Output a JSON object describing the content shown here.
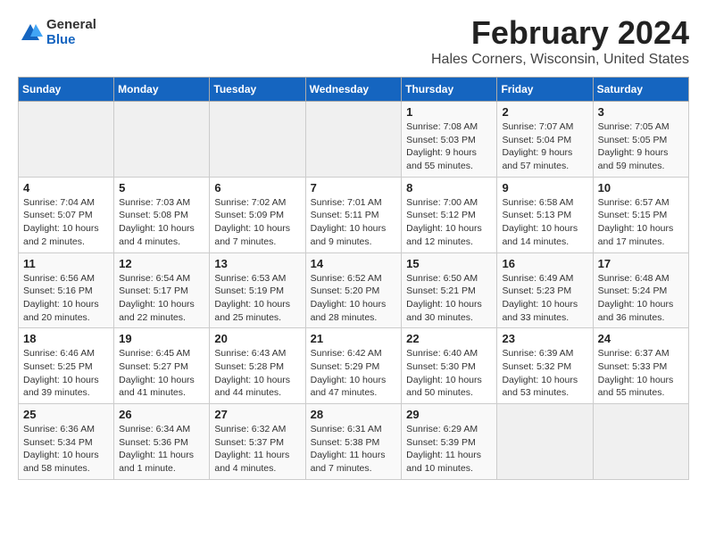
{
  "logo": {
    "general": "General",
    "blue": "Blue"
  },
  "title": "February 2024",
  "subtitle": "Hales Corners, Wisconsin, United States",
  "days_of_week": [
    "Sunday",
    "Monday",
    "Tuesday",
    "Wednesday",
    "Thursday",
    "Friday",
    "Saturday"
  ],
  "weeks": [
    [
      {
        "day": "",
        "info": ""
      },
      {
        "day": "",
        "info": ""
      },
      {
        "day": "",
        "info": ""
      },
      {
        "day": "",
        "info": ""
      },
      {
        "day": "1",
        "info": "Sunrise: 7:08 AM\nSunset: 5:03 PM\nDaylight: 9 hours\nand 55 minutes."
      },
      {
        "day": "2",
        "info": "Sunrise: 7:07 AM\nSunset: 5:04 PM\nDaylight: 9 hours\nand 57 minutes."
      },
      {
        "day": "3",
        "info": "Sunrise: 7:05 AM\nSunset: 5:05 PM\nDaylight: 9 hours\nand 59 minutes."
      }
    ],
    [
      {
        "day": "4",
        "info": "Sunrise: 7:04 AM\nSunset: 5:07 PM\nDaylight: 10 hours\nand 2 minutes."
      },
      {
        "day": "5",
        "info": "Sunrise: 7:03 AM\nSunset: 5:08 PM\nDaylight: 10 hours\nand 4 minutes."
      },
      {
        "day": "6",
        "info": "Sunrise: 7:02 AM\nSunset: 5:09 PM\nDaylight: 10 hours\nand 7 minutes."
      },
      {
        "day": "7",
        "info": "Sunrise: 7:01 AM\nSunset: 5:11 PM\nDaylight: 10 hours\nand 9 minutes."
      },
      {
        "day": "8",
        "info": "Sunrise: 7:00 AM\nSunset: 5:12 PM\nDaylight: 10 hours\nand 12 minutes."
      },
      {
        "day": "9",
        "info": "Sunrise: 6:58 AM\nSunset: 5:13 PM\nDaylight: 10 hours\nand 14 minutes."
      },
      {
        "day": "10",
        "info": "Sunrise: 6:57 AM\nSunset: 5:15 PM\nDaylight: 10 hours\nand 17 minutes."
      }
    ],
    [
      {
        "day": "11",
        "info": "Sunrise: 6:56 AM\nSunset: 5:16 PM\nDaylight: 10 hours\nand 20 minutes."
      },
      {
        "day": "12",
        "info": "Sunrise: 6:54 AM\nSunset: 5:17 PM\nDaylight: 10 hours\nand 22 minutes."
      },
      {
        "day": "13",
        "info": "Sunrise: 6:53 AM\nSunset: 5:19 PM\nDaylight: 10 hours\nand 25 minutes."
      },
      {
        "day": "14",
        "info": "Sunrise: 6:52 AM\nSunset: 5:20 PM\nDaylight: 10 hours\nand 28 minutes."
      },
      {
        "day": "15",
        "info": "Sunrise: 6:50 AM\nSunset: 5:21 PM\nDaylight: 10 hours\nand 30 minutes."
      },
      {
        "day": "16",
        "info": "Sunrise: 6:49 AM\nSunset: 5:23 PM\nDaylight: 10 hours\nand 33 minutes."
      },
      {
        "day": "17",
        "info": "Sunrise: 6:48 AM\nSunset: 5:24 PM\nDaylight: 10 hours\nand 36 minutes."
      }
    ],
    [
      {
        "day": "18",
        "info": "Sunrise: 6:46 AM\nSunset: 5:25 PM\nDaylight: 10 hours\nand 39 minutes."
      },
      {
        "day": "19",
        "info": "Sunrise: 6:45 AM\nSunset: 5:27 PM\nDaylight: 10 hours\nand 41 minutes."
      },
      {
        "day": "20",
        "info": "Sunrise: 6:43 AM\nSunset: 5:28 PM\nDaylight: 10 hours\nand 44 minutes."
      },
      {
        "day": "21",
        "info": "Sunrise: 6:42 AM\nSunset: 5:29 PM\nDaylight: 10 hours\nand 47 minutes."
      },
      {
        "day": "22",
        "info": "Sunrise: 6:40 AM\nSunset: 5:30 PM\nDaylight: 10 hours\nand 50 minutes."
      },
      {
        "day": "23",
        "info": "Sunrise: 6:39 AM\nSunset: 5:32 PM\nDaylight: 10 hours\nand 53 minutes."
      },
      {
        "day": "24",
        "info": "Sunrise: 6:37 AM\nSunset: 5:33 PM\nDaylight: 10 hours\nand 55 minutes."
      }
    ],
    [
      {
        "day": "25",
        "info": "Sunrise: 6:36 AM\nSunset: 5:34 PM\nDaylight: 10 hours\nand 58 minutes."
      },
      {
        "day": "26",
        "info": "Sunrise: 6:34 AM\nSunset: 5:36 PM\nDaylight: 11 hours\nand 1 minute."
      },
      {
        "day": "27",
        "info": "Sunrise: 6:32 AM\nSunset: 5:37 PM\nDaylight: 11 hours\nand 4 minutes."
      },
      {
        "day": "28",
        "info": "Sunrise: 6:31 AM\nSunset: 5:38 PM\nDaylight: 11 hours\nand 7 minutes."
      },
      {
        "day": "29",
        "info": "Sunrise: 6:29 AM\nSunset: 5:39 PM\nDaylight: 11 hours\nand 10 minutes."
      },
      {
        "day": "",
        "info": ""
      },
      {
        "day": "",
        "info": ""
      }
    ]
  ]
}
